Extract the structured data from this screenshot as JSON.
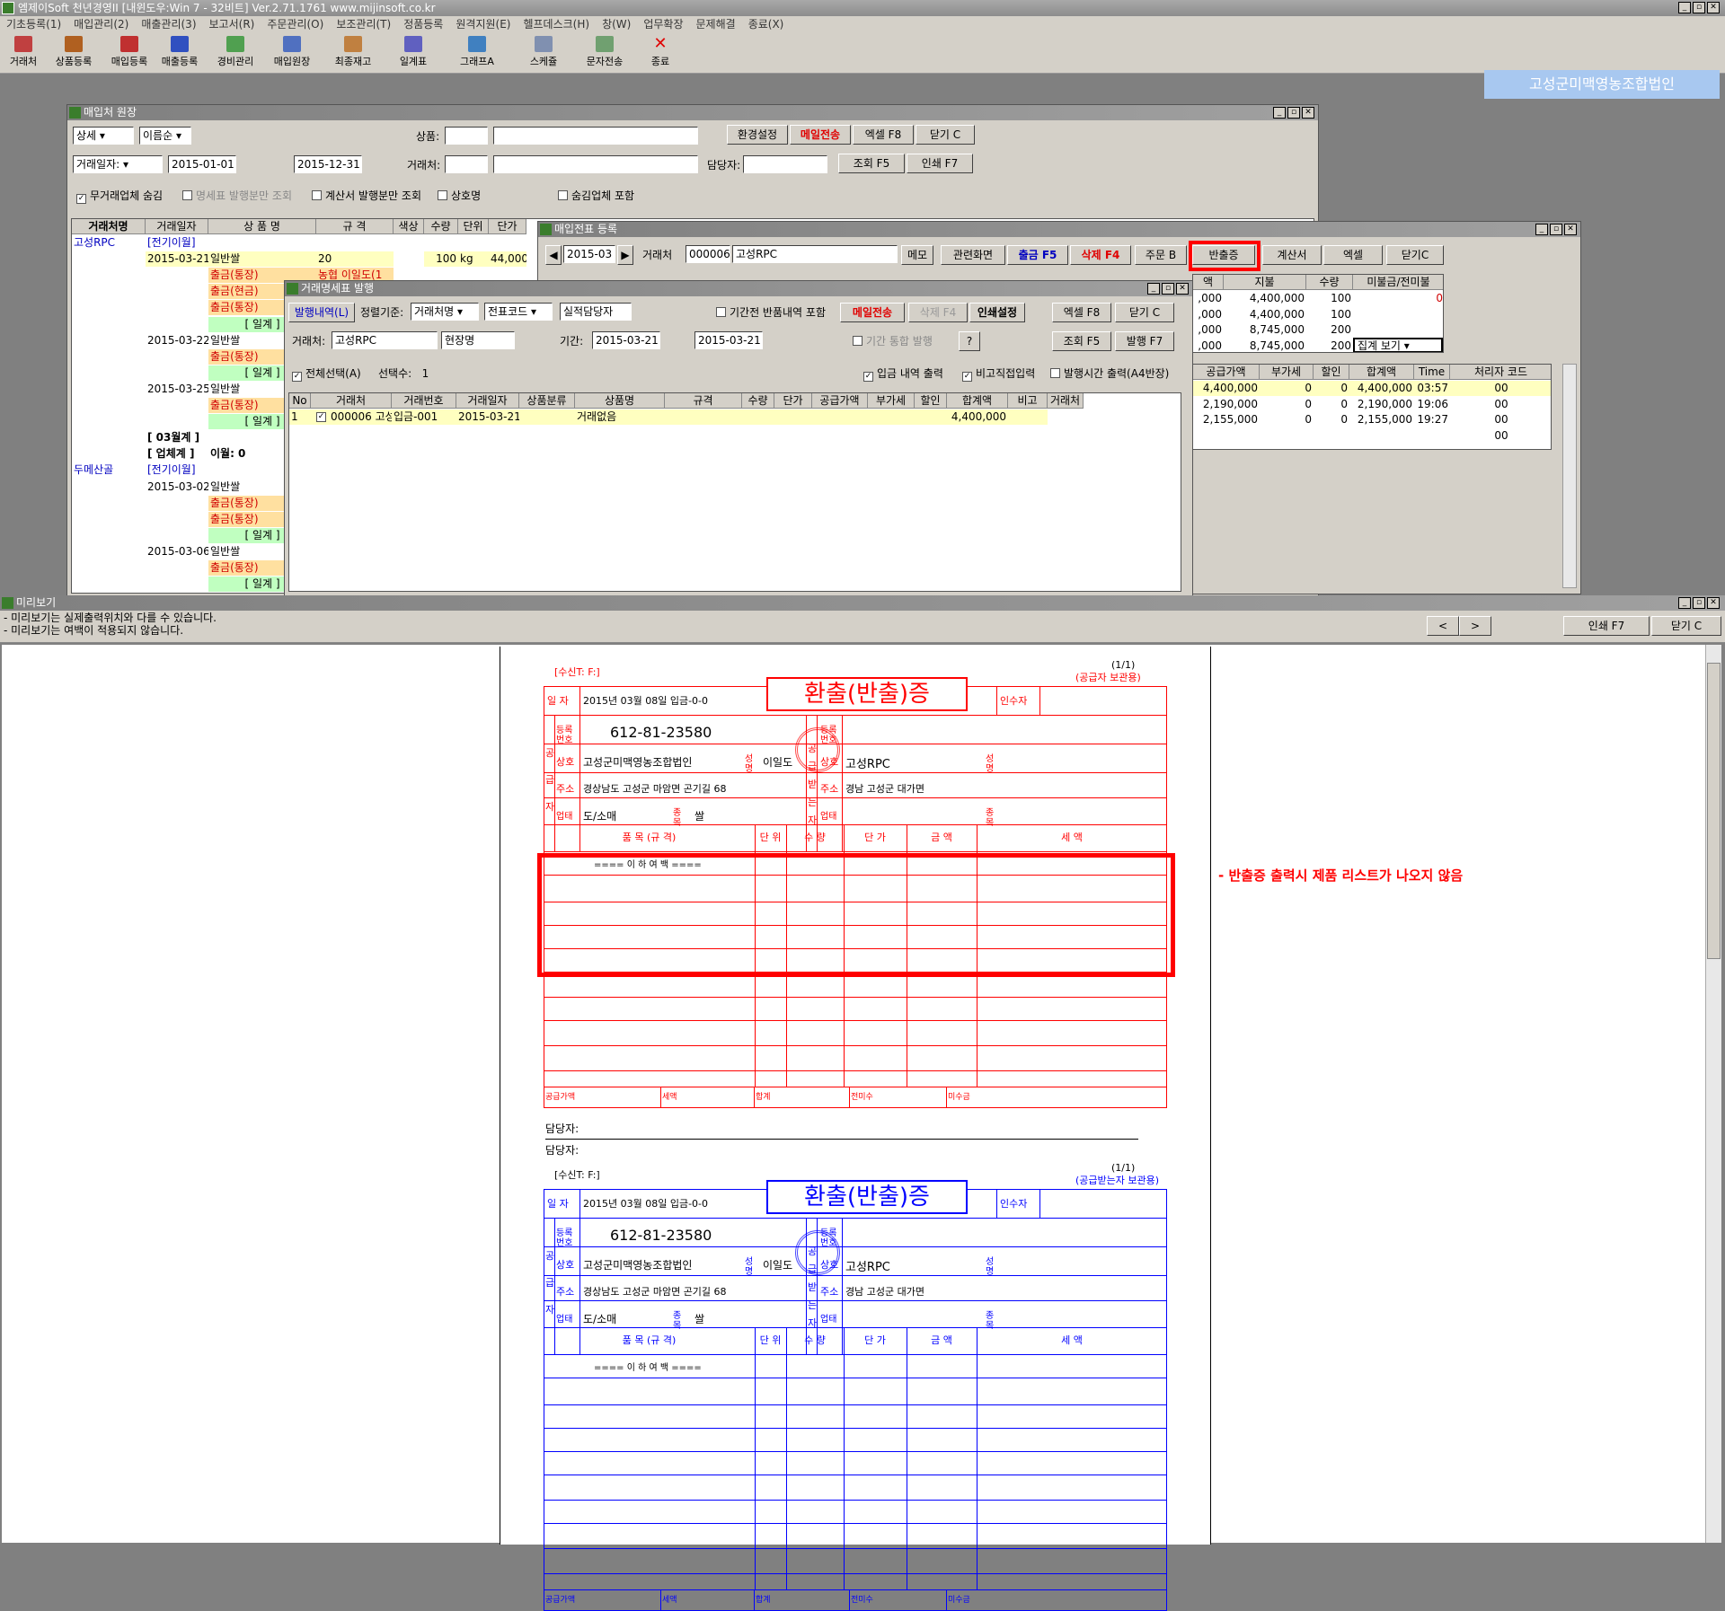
{
  "app": {
    "title": "엠제이Soft 천년경영II [내윈도우:Win 7 - 32비트] Ver.2.71.1761     www.mijinsoft.co.kr",
    "menu": [
      "기초등록(1)",
      "매입관리(2)",
      "매출관리(3)",
      "보고서(R)",
      "주문관리(O)",
      "보조관리(T)",
      "정품등록",
      "원격지원(E)",
      "헬프데스크(H)",
      "창(W)",
      "업무확장",
      "문제해결",
      "종료(X)"
    ],
    "toolbar": [
      "거래처",
      "상품등록",
      "매입등록",
      "매출등록",
      "경비관리",
      "매입원장",
      "최종재고",
      "일계표",
      "그래프A",
      "스케쥴",
      "문자전송",
      "종료"
    ],
    "company": "고성군미맥영농조합법인"
  },
  "ledger": {
    "title": "매입처 원장",
    "view_mode": "상세",
    "sort": "이름순",
    "product_label": "상품:",
    "btn_settings": "환경설정",
    "btn_mail": "메일전송",
    "btn_excel": "엑셀 F8",
    "btn_close": "닫기 C",
    "date_type": "거래일자:",
    "date_from": "2015-01-01",
    "date_to": "2015-12-31",
    "vendor_label": "거래처:",
    "manager_label": "담당자:",
    "btn_query": "조회 F5",
    "btn_print": "인쇄 F7",
    "chk_hide_no_trade": "무거래업체 숨김",
    "chk_statement_only": "명세표 발행분만 조회",
    "chk_invoice_only": "계산서 발행분만 조회",
    "chk_company_name": "상호명",
    "chk_include_hidden": "숨김업체 포함",
    "columns": [
      "거래처명",
      "거래일자",
      "상 품 명",
      "규 격",
      "색상",
      "수량",
      "단위",
      "단가"
    ],
    "rows": [
      {
        "vendor": "고성RPC",
        "date": "[전기이월]",
        "item": "",
        "spec": "",
        "qty": "",
        "unit": "",
        "price": ""
      },
      {
        "vendor": "",
        "date": "2015-03-21",
        "item": "일반쌀",
        "spec": "20",
        "qty": "100",
        "unit": "kg",
        "price": "44,000"
      },
      {
        "vendor": "",
        "date": "",
        "item": "출금(통장)",
        "spec": "농협 이일도(1",
        "qty": "",
        "unit": "",
        "price": ""
      },
      {
        "vendor": "",
        "date": "",
        "item": "출금(현금)",
        "spec": "",
        "qty": "",
        "unit": "",
        "price": ""
      },
      {
        "vendor": "",
        "date": "",
        "item": "출금(통장)",
        "spec": "",
        "qty": "",
        "unit": "",
        "price": ""
      },
      {
        "vendor": "",
        "date": "",
        "item": "[ 일계 ]",
        "spec": "",
        "qty": "",
        "unit": "",
        "price": ""
      },
      {
        "vendor": "",
        "date": "2015-03-22",
        "item": "일반쌀",
        "spec": "",
        "qty": "",
        "unit": "",
        "price": ""
      },
      {
        "vendor": "",
        "date": "",
        "item": "출금(통장)",
        "spec": "",
        "qty": "",
        "unit": "",
        "price": ""
      },
      {
        "vendor": "",
        "date": "",
        "item": "[ 일계 ]",
        "spec": "",
        "qty": "",
        "unit": "",
        "price": ""
      },
      {
        "vendor": "",
        "date": "2015-03-25",
        "item": "일반쌀",
        "spec": "",
        "qty": "",
        "unit": "",
        "price": ""
      },
      {
        "vendor": "",
        "date": "",
        "item": "출금(통장)",
        "spec": "",
        "qty": "",
        "unit": "",
        "price": ""
      },
      {
        "vendor": "",
        "date": "",
        "item": "[ 일계 ]",
        "spec": "",
        "qty": "",
        "unit": "",
        "price": ""
      },
      {
        "vendor": "",
        "date": "[ 03월계 ]",
        "item": "",
        "spec": "",
        "qty": "",
        "unit": "",
        "price": ""
      },
      {
        "vendor": "",
        "date": "[ 업체계 ]",
        "item": "이월: 0",
        "spec": "",
        "qty": "",
        "unit": "",
        "price": ""
      },
      {
        "vendor": "두메산골",
        "date": "[전기이월]",
        "item": "",
        "spec": "",
        "qty": "",
        "unit": "",
        "price": ""
      },
      {
        "vendor": "",
        "date": "2015-03-02",
        "item": "일반쌀",
        "spec": "",
        "qty": "",
        "unit": "",
        "price": ""
      },
      {
        "vendor": "",
        "date": "",
        "item": "출금(통장)",
        "spec": "",
        "qty": "",
        "unit": "",
        "price": ""
      },
      {
        "vendor": "",
        "date": "",
        "item": "출금(통장)",
        "spec": "",
        "qty": "",
        "unit": "",
        "price": ""
      },
      {
        "vendor": "",
        "date": "",
        "item": "[ 일계 ]",
        "spec": "",
        "qty": "",
        "unit": "",
        "price": ""
      },
      {
        "vendor": "",
        "date": "2015-03-06",
        "item": "일반쌀",
        "spec": "",
        "qty": "",
        "unit": "",
        "price": ""
      },
      {
        "vendor": "",
        "date": "",
        "item": "출금(통장)",
        "spec": "",
        "qty": "",
        "unit": "",
        "price": ""
      },
      {
        "vendor": "",
        "date": "",
        "item": "[ 일계 ]",
        "spec": "",
        "qty": "",
        "unit": "",
        "price": ""
      }
    ]
  },
  "purchase": {
    "title": "매입전표 등록",
    "month": "2015-03",
    "vendor_label": "거래처",
    "vendor_code": "000006",
    "vendor_name": "고성RPC",
    "btn_memo": "메모",
    "btn_related": "관련화면",
    "btn_pay": "출금 F5",
    "btn_delete": "삭제 F4",
    "btn_order": "주문 B",
    "btn_return": "반출증",
    "btn_invoice": "계산서",
    "btn_excel": "엑셀",
    "btn_close": "닫기C",
    "upper_cols": [
      "액",
      "지불",
      "수량",
      "미불금/전미불"
    ],
    "upper_rows": [
      {
        "a": ",000",
        "b": "4,400,000",
        "c": "100",
        "d": "0"
      },
      {
        "a": ",000",
        "b": "4,400,000",
        "c": "100",
        "d": ""
      },
      {
        "a": ",000",
        "b": "8,745,000",
        "c": "200",
        "d": ""
      },
      {
        "a": ",000",
        "b": "8,745,000",
        "c": "200",
        "d": ""
      }
    ],
    "summary_select": "집계 보기",
    "lower_cols": [
      "공급가액",
      "부가세",
      "할인",
      "합계액",
      "Time",
      "처리자 코드"
    ],
    "lower_rows": [
      {
        "supply": "4,400,000",
        "vat": "0",
        "disc": "0",
        "total": "4,400,000",
        "time": "03:57",
        "code": "00"
      },
      {
        "supply": "2,190,000",
        "vat": "0",
        "disc": "0",
        "total": "2,190,000",
        "time": "19:06",
        "code": "00"
      },
      {
        "supply": "2,155,000",
        "vat": "0",
        "disc": "0",
        "total": "2,155,000",
        "time": "19:27",
        "code": "00"
      },
      {
        "supply": "",
        "vat": "",
        "disc": "",
        "total": "",
        "time": "",
        "code": "00"
      }
    ]
  },
  "statement": {
    "title": "거래명세표 발행",
    "tab_issued": "발행내역(L)",
    "sort_label": "정렬기준:",
    "sort_value": "거래처명",
    "sort2_value": "전표코드",
    "actual_manager": "실적담당자",
    "chk_include_returns": "기간전 반품내역 포함",
    "btn_mail": "메일전송",
    "btn_delete": "삭제 F4",
    "btn_print_settings": "인쇄설정",
    "btn_excel": "엑셀 F8",
    "btn_close": "닫기 C",
    "vendor_label": "거래처:",
    "vendor_value": "고성RPC",
    "site_value": "현장명",
    "period_label": "기간:",
    "period_from": "2015-03-21",
    "period_to": "2015-03-21",
    "chk_period_merge": "기간 통합 발행",
    "btn_help": "?",
    "btn_query": "조회 F5",
    "btn_issue": "발행 F7",
    "chk_select_all": "전체선택(A)",
    "selected_label": "선택수:",
    "selected_count": "1",
    "chk_deposit_print": "입금 내역 출력",
    "chk_note_input": "비고직접입력",
    "chk_issue_time": "발행시간 출력(A4반장)",
    "columns": [
      "No",
      "거래처",
      "거래번호",
      "거래일자",
      "상품분류",
      "상품명",
      "규격",
      "수량",
      "단가",
      "공급가액",
      "부가세",
      "할인",
      "합계액",
      "비고",
      "거래처"
    ],
    "row": {
      "no": "1",
      "vendor": "000006 고성",
      "num": "입금-001",
      "date": "2015-03-21",
      "cat": "",
      "item": "거래없음",
      "spec": "",
      "qty": "",
      "price": "",
      "supply": "",
      "vat": "",
      "disc": "",
      "total": "4,400,000",
      "note": ""
    }
  },
  "preview": {
    "title": "미리보기",
    "note1": "- 미리보기는 실제출력위치와 다를 수 있습니다.",
    "note2": "- 미리보기는 여백이 적용되지 않습니다.",
    "btn_prev": "<",
    "btn_next": ">",
    "btn_print": "인쇄 F7",
    "btn_close": "닫기 C",
    "annotation": "- 반출증 출력시 제품 리스트가 나오지 않음"
  },
  "form": {
    "receiver": "[수신T:  F:]",
    "page": "(1/1)",
    "copy_supplier": "(공급자 보관용)",
    "copy_receiver": "(공급받는자 보관용)",
    "title": "환출(반출)증",
    "date_label": "일 자",
    "date_value": "2015년 03월 08일 입금-0-0",
    "receiver_label": "인수자",
    "reg_no": "612-81-23580",
    "supplier_label": "공 급 자",
    "buyer_label": "공 급 받 는 자",
    "reg_label": "등록번호",
    "name_label": "상호",
    "sign_label": "성명",
    "addr_label": "주소",
    "biz_label": "업태",
    "kind_label": "종목",
    "supplier_name": "고성군미맥영농조합법인",
    "supplier_rep": "이일도",
    "supplier_addr": "경상남도 고성군 마암면 곤기길 68",
    "supplier_biz": "도/소매",
    "supplier_kind": "쌀",
    "buyer_name": "고성RPC",
    "buyer_addr": "경남 고성군 대가면",
    "col_item": "품 목 (규 격)",
    "col_unit": "단 위",
    "col_qty": "수 량",
    "col_price": "단 가",
    "col_amount": "금 액",
    "col_tax": "세 액",
    "blank_line": "==== 이 하 여 백 ====",
    "f_supply": "공급가액",
    "f_tax": "세액",
    "f_total": "합계",
    "f_prev_unpaid": "전미수",
    "f_unpaid": "미수금",
    "manager_label": "담당자:"
  },
  "colors": {
    "red_form": "#ff0000",
    "blue_form": "#0000ff",
    "highlight": "#ff0000"
  }
}
